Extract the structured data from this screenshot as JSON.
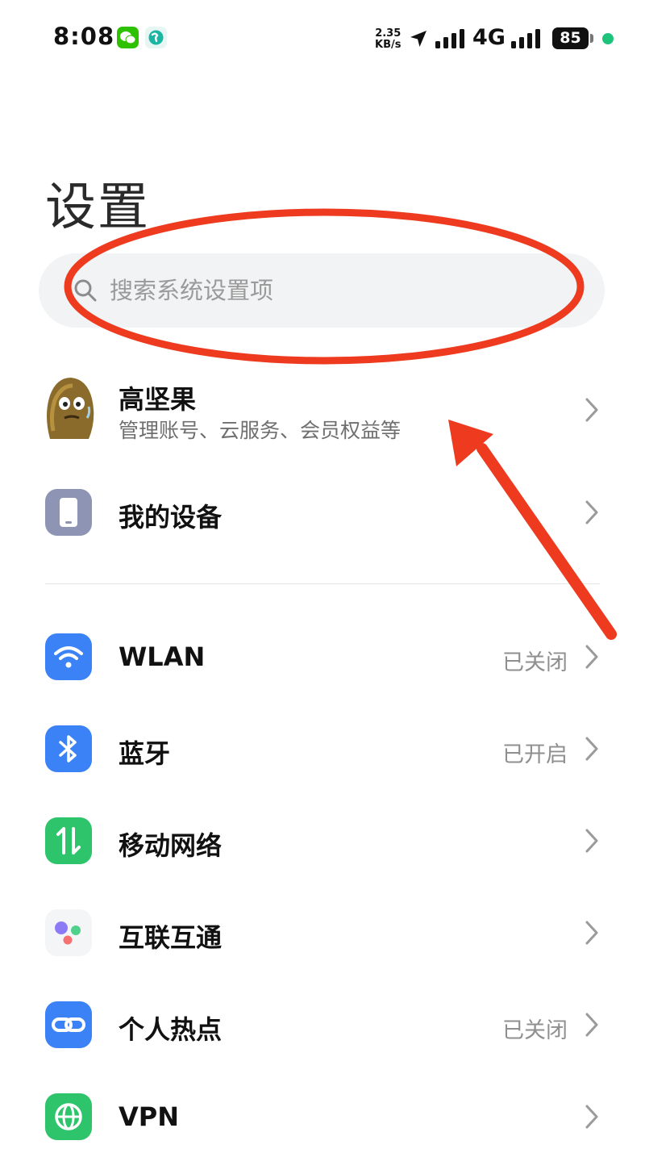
{
  "status_bar": {
    "time": "8:08",
    "net_speed_value": "2.35",
    "net_speed_unit": "KB/s",
    "network_type": "4G",
    "battery": "85"
  },
  "header": {
    "title": "设置"
  },
  "search": {
    "placeholder": "搜索系统设置项"
  },
  "account": {
    "name": "高坚果",
    "subtitle": "管理账号、云服务、会员权益等"
  },
  "items": [
    {
      "label": "我的设备",
      "value": "",
      "icon": "phone-icon",
      "color": "#8e94b3"
    },
    {
      "label": "WLAN",
      "value": "已关闭",
      "icon": "wifi-icon",
      "color": "#3b82f6"
    },
    {
      "label": "蓝牙",
      "value": "已开启",
      "icon": "bluetooth-icon",
      "color": "#3b82f6"
    },
    {
      "label": "移动网络",
      "value": "",
      "icon": "mobile-data-icon",
      "color": "#2ec46b"
    },
    {
      "label": "互联互通",
      "value": "",
      "icon": "connect-dots-icon",
      "color": "#f4f5f7"
    },
    {
      "label": "个人热点",
      "value": "已关闭",
      "icon": "hotspot-icon",
      "color": "#3b82f6"
    },
    {
      "label": "VPN",
      "value": "",
      "icon": "globe-icon",
      "color": "#2ec46b"
    }
  ],
  "annotation_color": "#ee3a1f"
}
